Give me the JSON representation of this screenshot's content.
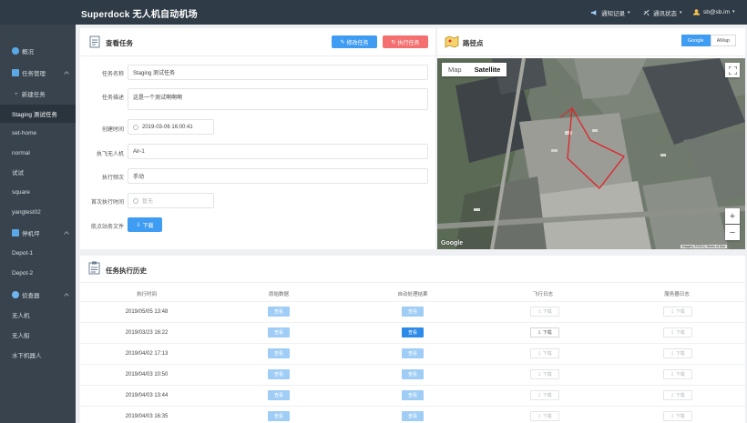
{
  "app": {
    "title": "Superdock 无人机自动机场"
  },
  "topbar": {
    "notify_label": "通知记录",
    "comm_label": "通讯状态",
    "user_label": "sb@sb.im"
  },
  "sidebar": {
    "items": [
      {
        "label": "概况"
      },
      {
        "label": "任务管理"
      },
      {
        "label": "新建任务"
      },
      {
        "label": "Staging 测试任务"
      },
      {
        "label": "set-home"
      },
      {
        "label": "normal"
      },
      {
        "label": "试试"
      },
      {
        "label": "square"
      },
      {
        "label": "yangtest02"
      },
      {
        "label": "停机坪"
      },
      {
        "label": "Depot-1"
      },
      {
        "label": "Depot-2"
      },
      {
        "label": "侦查器"
      },
      {
        "label": "无人机"
      },
      {
        "label": "无人船"
      },
      {
        "label": "水下机器人"
      }
    ]
  },
  "task": {
    "title": "查看任务",
    "edit_button": "修改任务",
    "execute_button": "执行任务",
    "fields": {
      "name_label": "任务名称",
      "name_value": "Staging 测试任务",
      "desc_label": "任务描述",
      "desc_value": "这是一个测试啊啊啊",
      "created_label": "创建时间",
      "created_value": "2019-03-06 16:00:41",
      "drone_label": "执飞无人机",
      "drone_value": "Air-1",
      "freq_label": "执行频次",
      "freq_value": "手动",
      "first_label": "首次执行时间",
      "first_placeholder": "暂无",
      "waypoint_label": "航点站务文件",
      "download_label": "下载"
    }
  },
  "map": {
    "title": "路径点",
    "tab_google": "Google",
    "tab_amap": "AMap",
    "type_map": "Map",
    "type_satellite": "Satellite",
    "zoom_in": "+",
    "zoom_out": "−",
    "attribution": "Google",
    "credit": "Imagery ©2019 | Terms of Use"
  },
  "history": {
    "title": "任务执行历史",
    "columns": [
      "执行时间",
      "原始数据",
      "自动处理结果",
      "飞行日志",
      "服务器日志"
    ],
    "view_label": "查看",
    "download_label": "下载",
    "rows": [
      {
        "time": "2019/05/05 13:48",
        "result_active": false,
        "flight_active": false
      },
      {
        "time": "2019/03/23 16:22",
        "result_active": true,
        "flight_active": true
      },
      {
        "time": "2019/04/02 17:13",
        "result_active": false,
        "flight_active": false
      },
      {
        "time": "2019/04/03 10:50",
        "result_active": false,
        "flight_active": false
      },
      {
        "time": "2019/04/03 13:44",
        "result_active": false,
        "flight_active": false
      },
      {
        "time": "2019/04/03 16:35",
        "result_active": false,
        "flight_active": false
      }
    ]
  },
  "colors": {
    "accent": "#3f9cf3",
    "danger": "#f46f6f",
    "sidebar": "#38434d",
    "topbar": "#2f3b46",
    "route": "#e0232a"
  }
}
